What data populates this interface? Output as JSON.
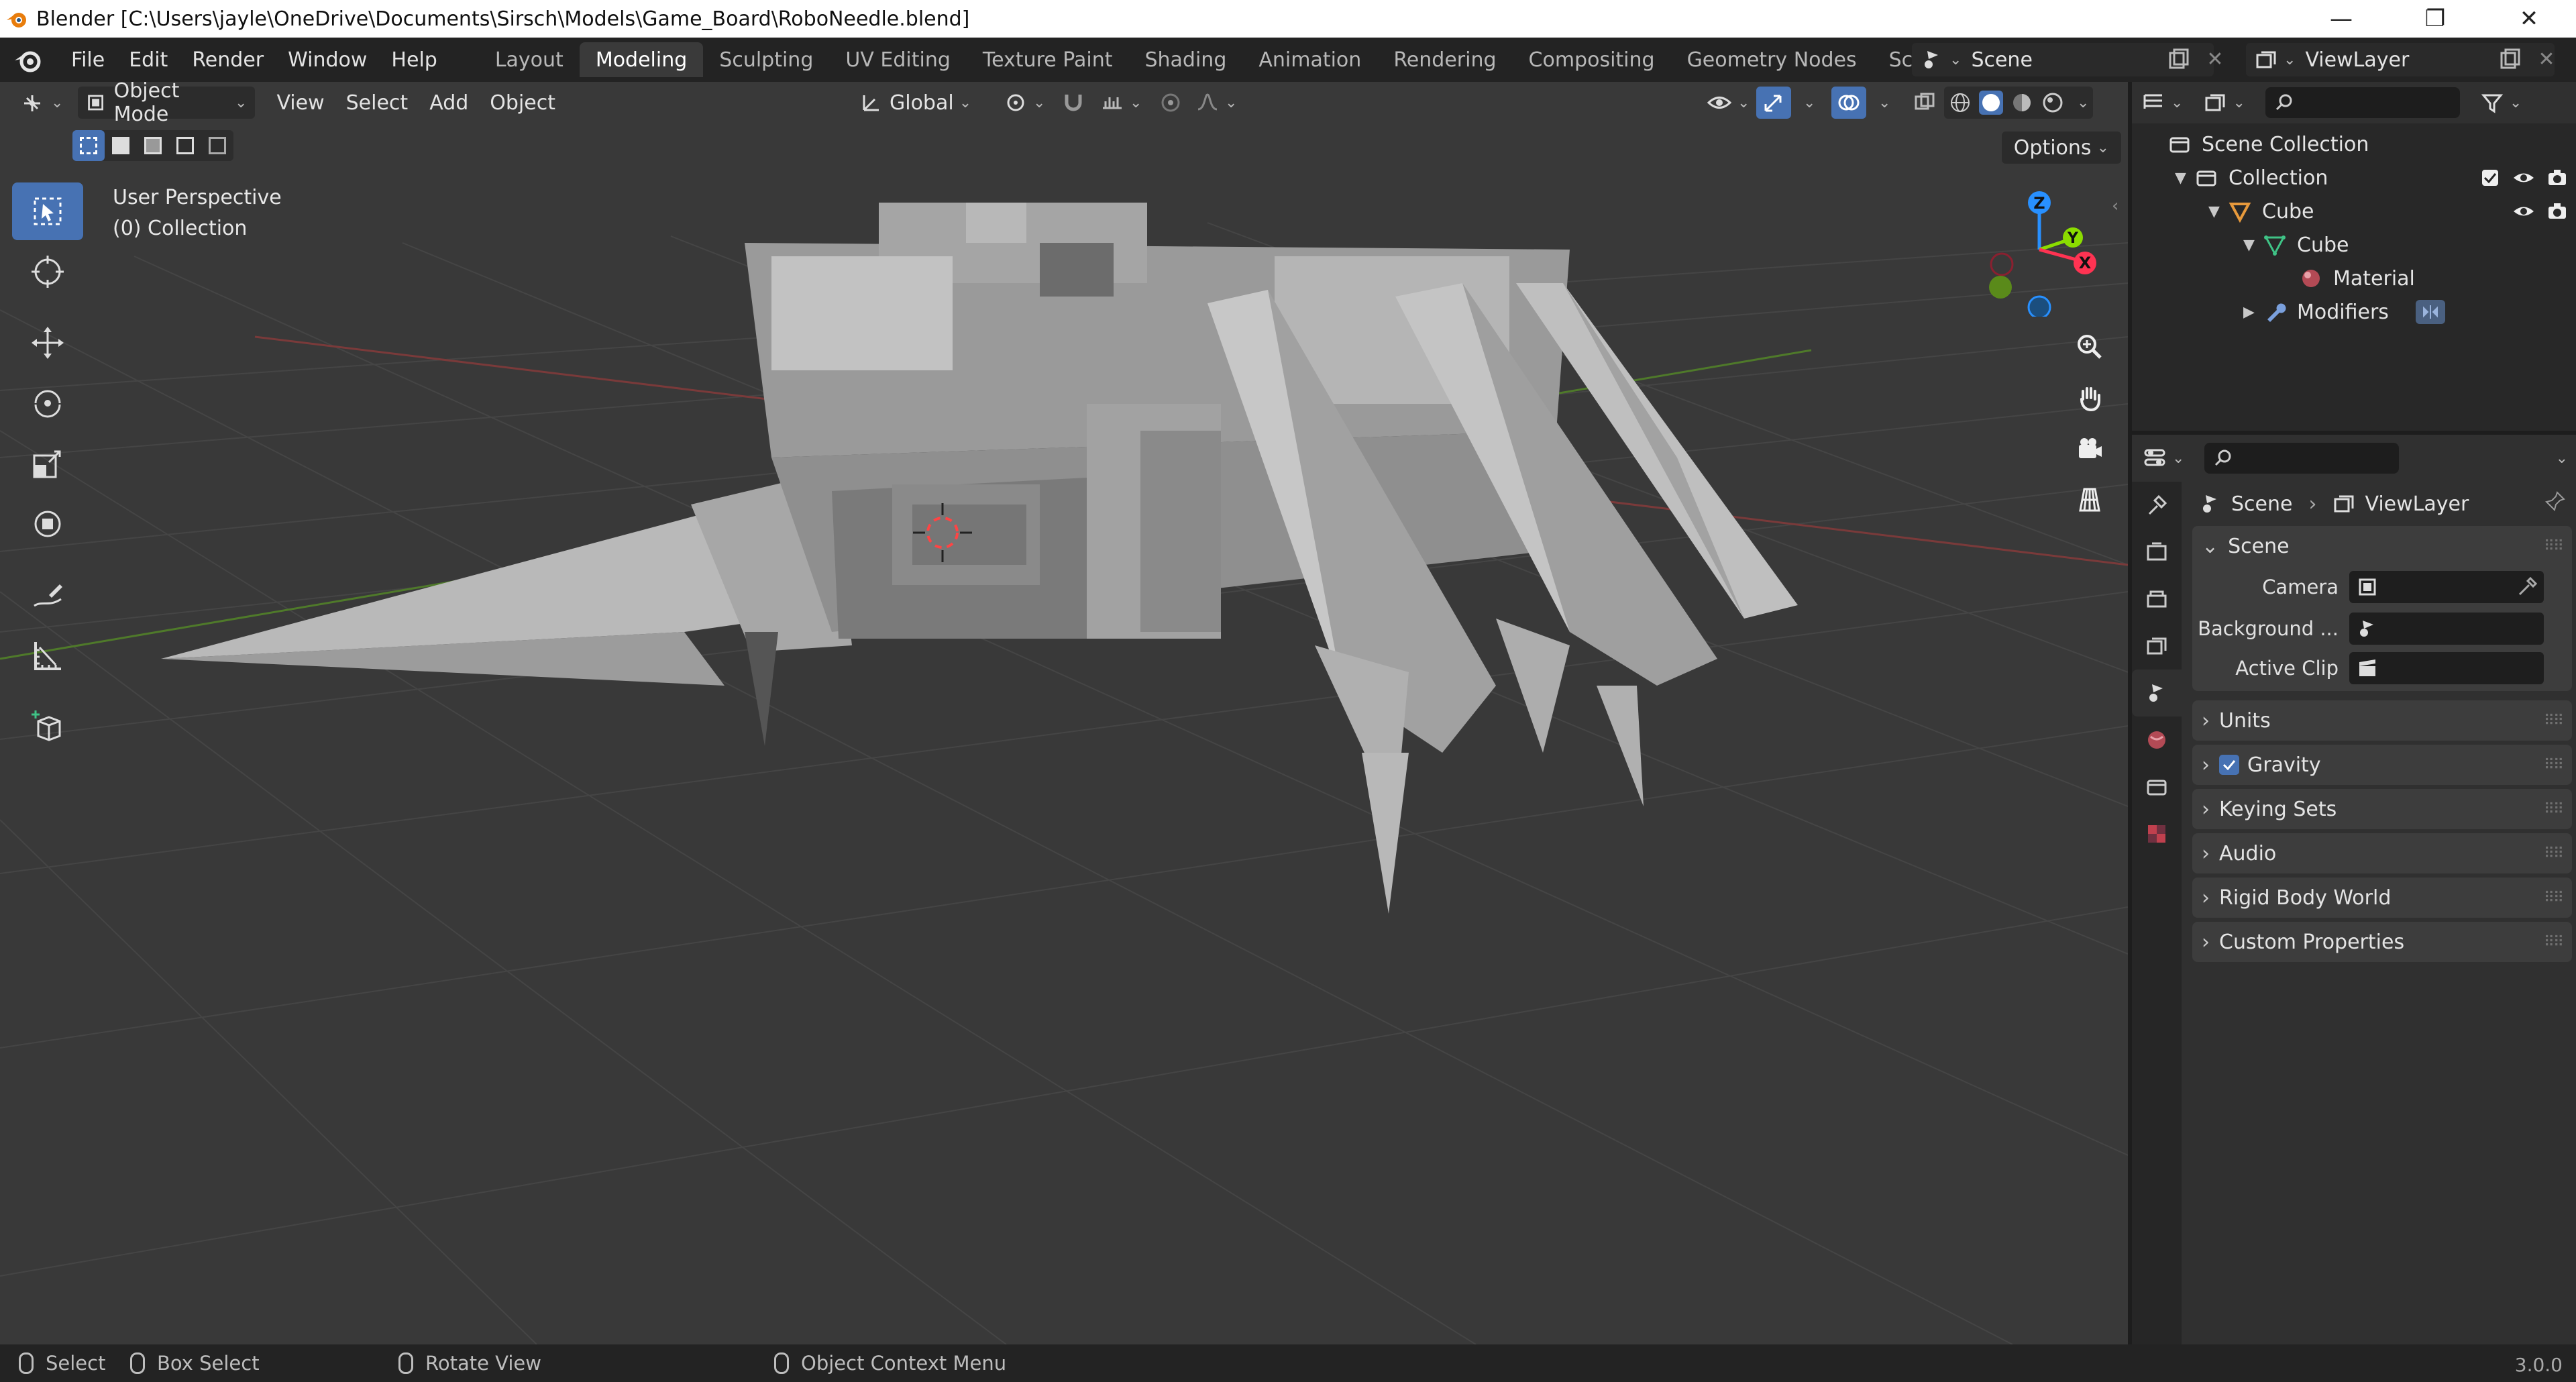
{
  "window": {
    "title": "Blender [C:\\Users\\jayle\\OneDrive\\Documents\\Sirsch\\Models\\Game_Board\\RoboNeedle.blend]",
    "controls": [
      "—",
      "❐",
      "✕"
    ]
  },
  "menu": [
    "File",
    "Edit",
    "Render",
    "Window",
    "Help"
  ],
  "workspaces": {
    "tabs": [
      "Layout",
      "Modeling",
      "Sculpting",
      "UV Editing",
      "Texture Paint",
      "Shading",
      "Animation",
      "Rendering",
      "Compositing",
      "Geometry Nodes",
      "Scripting"
    ],
    "active": "Modeling",
    "add": "+"
  },
  "scene_selector": {
    "label": "Scene"
  },
  "viewlayer_selector": {
    "label": "ViewLayer"
  },
  "viewport": {
    "mode": "Object Mode",
    "menus": [
      "View",
      "Select",
      "Add",
      "Object"
    ],
    "transform_orientation": "Global",
    "options": "Options",
    "info_line1": "User Perspective",
    "info_line2": "(0) Collection",
    "gizmo": {
      "x": "X",
      "y": "Y",
      "z": "Z"
    }
  },
  "outliner": {
    "scene_collection": "Scene Collection",
    "collection": "Collection",
    "cube_object": "Cube",
    "cube_mesh": "Cube",
    "material": "Material",
    "modifiers": "Modifiers"
  },
  "properties": {
    "breadcrumb": {
      "scene": "Scene",
      "viewlayer": "ViewLayer"
    },
    "scene_panel": "Scene",
    "rows": {
      "camera": "Camera",
      "background": "Background ...",
      "active_clip": "Active Clip"
    },
    "panels": [
      "Units",
      "Gravity",
      "Keying Sets",
      "Audio",
      "Rigid Body World",
      "Custom Properties"
    ],
    "gravity_checked": true
  },
  "statusbar": {
    "select": "Select",
    "box_select": "Box Select",
    "rotate_view": "Rotate View",
    "context_menu": "Object Context Menu",
    "version": "3.0.0"
  },
  "colors": {
    "accent": "#4772b3",
    "axis_x": "#ff3352",
    "axis_y": "#8bdc00",
    "axis_z": "#2890ff",
    "outliner_orange": "#e89a3c",
    "mesh_green": "#3fc386"
  }
}
